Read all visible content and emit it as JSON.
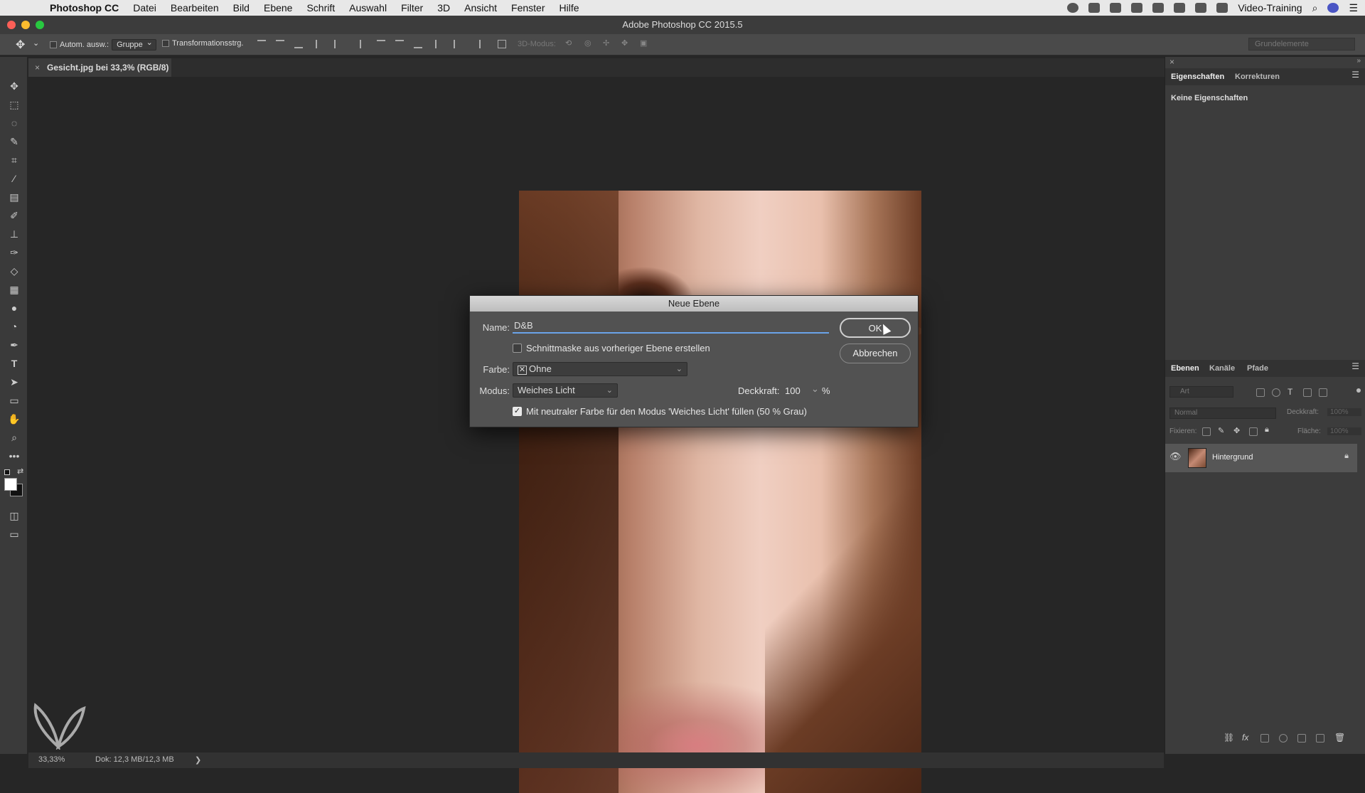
{
  "menubar": {
    "app_name": "Photoshop CC",
    "items": [
      "Datei",
      "Bearbeiten",
      "Bild",
      "Ebene",
      "Schrift",
      "Auswahl",
      "Filter",
      "3D",
      "Ansicht",
      "Fenster",
      "Hilfe"
    ],
    "user": "Video-Training"
  },
  "window": {
    "title": "Adobe Photoshop CC 2015.5"
  },
  "options": {
    "auto_select_label": "Autom. ausw.:",
    "auto_select_value": "Gruppe",
    "transform_label": "Transformationsstrg.",
    "mode3d_label": "3D-Modus:",
    "workspace": "Grundelemente"
  },
  "document": {
    "tab_title": "Gesicht.jpg bei 33,3% (RGB/8)",
    "close": "×"
  },
  "dialog": {
    "title": "Neue Ebene",
    "name_label": "Name:",
    "name_value": "D&B",
    "clipping_label": "Schnittmaske aus vorheriger Ebene erstellen",
    "clipping_checked": false,
    "color_label": "Farbe:",
    "color_value": "Ohne",
    "mode_label": "Modus:",
    "mode_value": "Weiches Licht",
    "opacity_label": "Deckkraft:",
    "opacity_value": "100",
    "opacity_unit": "%",
    "neutral_label": "Mit neutraler Farbe für den Modus 'Weiches Licht' füllen (50 % Grau)",
    "neutral_checked": true,
    "ok": "OK",
    "cancel": "Abbrechen"
  },
  "properties_panel": {
    "tabs": [
      "Eigenschaften",
      "Korrekturen"
    ],
    "content": "Keine Eigenschaften"
  },
  "layers_panel": {
    "tabs": [
      "Ebenen",
      "Kanäle",
      "Pfade"
    ],
    "filter_placeholder": "Art",
    "blend_mode": "Normal",
    "opacity_label": "Deckkraft:",
    "opacity_value": "100%",
    "lock_label": "Fixieren:",
    "fill_label": "Fläche:",
    "fill_value": "100%",
    "layers": [
      {
        "name": "Hintergrund",
        "visible": true,
        "locked": true
      }
    ]
  },
  "status": {
    "zoom": "33,33%",
    "doc_info": "Dok: 12,3 MB/12,3 MB",
    "arrow": "❯"
  },
  "colors": {
    "accent": "#6aa3e9",
    "panel": "#3c3c3c",
    "canvas_bg": "#262626"
  }
}
